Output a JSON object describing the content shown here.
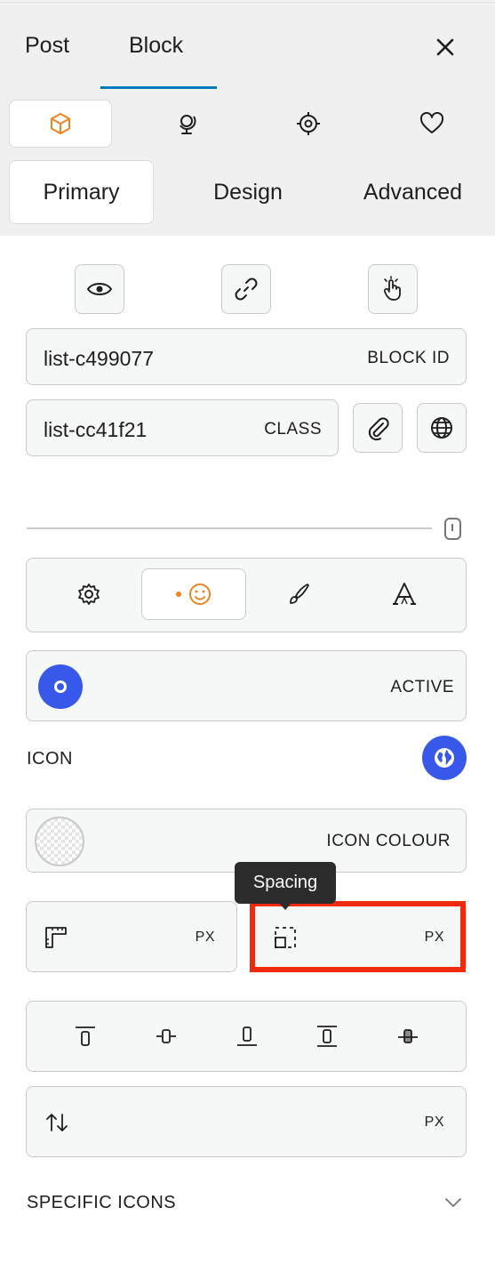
{
  "tabs": {
    "post": "Post",
    "block": "Block"
  },
  "icon_tabs": [
    "cube-icon",
    "globe-stand-icon",
    "target-icon",
    "heart-icon"
  ],
  "segments": {
    "primary": "Primary",
    "design": "Design",
    "advanced": "Advanced"
  },
  "quick_actions": [
    "eye-icon",
    "link-icon",
    "hand-pointer-icon"
  ],
  "block_id": {
    "value": "list-c499077",
    "label": "BLOCK ID"
  },
  "class_field": {
    "value": "list-cc41f21",
    "label": "CLASS"
  },
  "sub_tabs": [
    "gear-icon",
    "smiley-icon",
    "brush-icon",
    "typography-icon"
  ],
  "active_row": {
    "label": "ACTIVE"
  },
  "icon_section": {
    "label": "ICON"
  },
  "icon_colour": {
    "label": "ICON COLOUR"
  },
  "tooltip": {
    "text": "Spacing"
  },
  "size_field": {
    "unit": "PX"
  },
  "spacing_field": {
    "unit": "PX"
  },
  "alignment": [
    "align-top-icon",
    "align-center-icon",
    "align-bottom-icon",
    "align-stretch-icon",
    "align-baseline-icon"
  ],
  "vertical_field": {
    "unit": "PX"
  },
  "specific_icons": {
    "label": "SPECIFIC ICONS"
  },
  "colors": {
    "accent_blue": "#3858e9",
    "wp_blue": "#007cba",
    "orange": "#f0831f",
    "highlight_red": "#f22a0c"
  }
}
